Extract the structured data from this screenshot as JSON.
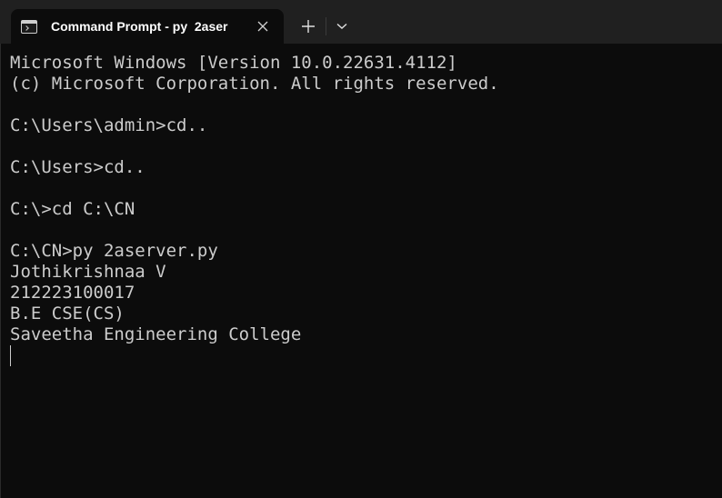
{
  "tab": {
    "title": "Command Prompt - py  2aser",
    "icon": "terminal-icon",
    "close_icon": "close-icon"
  },
  "toolbar": {
    "new_tab_icon": "plus-icon",
    "dropdown_icon": "chevron-down-icon"
  },
  "terminal": {
    "lines": [
      "Microsoft Windows [Version 10.0.22631.4112]",
      "(c) Microsoft Corporation. All rights reserved.",
      "",
      "C:\\Users\\admin>cd..",
      "",
      "C:\\Users>cd..",
      "",
      "C:\\>cd C:\\CN",
      "",
      "C:\\CN>py 2aserver.py",
      "Jothikrishnaa V",
      "212223100017",
      "B.E CSE(CS)",
      "Saveetha Engineering College"
    ]
  },
  "colors": {
    "terminal_bg": "#0c0c0c",
    "titlebar_bg": "#202020",
    "text": "#cccccc"
  }
}
